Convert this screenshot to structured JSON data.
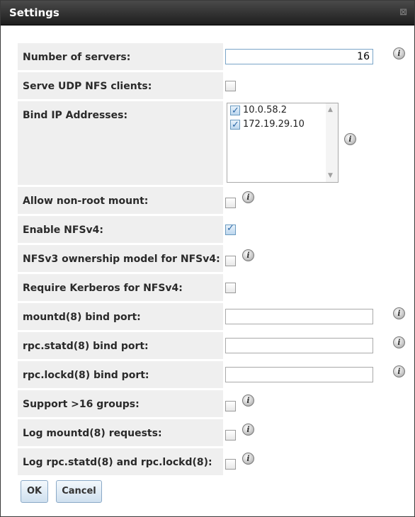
{
  "window": {
    "title": "Settings",
    "close_icon": "close-icon"
  },
  "rows": [
    {
      "label": "Number of servers:",
      "type": "text",
      "value": "16",
      "info": true
    },
    {
      "label": "Serve UDP NFS clients:",
      "type": "checkbox",
      "checked": false,
      "info": false
    },
    {
      "label": "Bind IP Addresses:",
      "type": "list",
      "info": true,
      "items": [
        {
          "label": "10.0.58.2",
          "checked": true
        },
        {
          "label": "172.19.29.10",
          "checked": true
        }
      ]
    },
    {
      "label": "Allow non-root mount:",
      "type": "checkbox",
      "checked": false,
      "info": true
    },
    {
      "label": "Enable NFSv4:",
      "type": "checkbox",
      "checked": true,
      "info": false
    },
    {
      "label": "NFSv3 ownership model for NFSv4:",
      "type": "checkbox",
      "checked": false,
      "info": true
    },
    {
      "label": "Require Kerberos for NFSv4:",
      "type": "checkbox",
      "checked": false,
      "info": false
    },
    {
      "label": "mountd(8) bind port:",
      "type": "text",
      "value": "",
      "info": true
    },
    {
      "label": "rpc.statd(8) bind port:",
      "type": "text",
      "value": "",
      "info": true
    },
    {
      "label": "rpc.lockd(8) bind port:",
      "type": "text",
      "value": "",
      "info": true
    },
    {
      "label": "Support >16 groups:",
      "type": "checkbox",
      "checked": false,
      "info": true
    },
    {
      "label": "Log mountd(8) requests:",
      "type": "checkbox",
      "checked": false,
      "info": true
    },
    {
      "label": "Log rpc.statd(8) and rpc.lockd(8):",
      "type": "checkbox",
      "checked": false,
      "info": true
    }
  ],
  "buttons": {
    "ok": "OK",
    "cancel": "Cancel"
  },
  "info_icon_glyph": "i"
}
